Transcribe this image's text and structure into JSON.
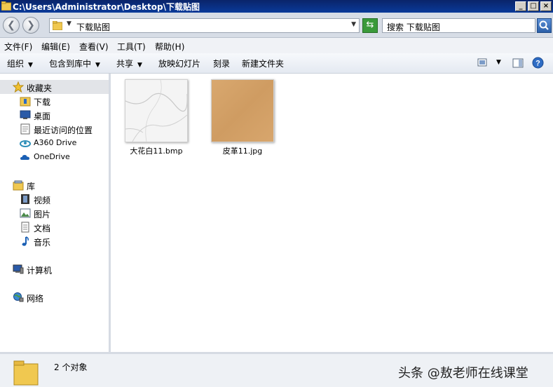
{
  "window": {
    "title": "C:\\Users\\Administrator\\Desktop\\下载贴图"
  },
  "address": {
    "path": "下载贴图",
    "search_placeholder": "搜索 下载贴图"
  },
  "menu": [
    "文件(F)",
    "编辑(E)",
    "查看(V)",
    "工具(T)",
    "帮助(H)"
  ],
  "toolbar": {
    "organize": "组织",
    "include": "包含到库中",
    "share": "共享",
    "slideshow": "放映幻灯片",
    "burn": "刻录",
    "new_folder": "新建文件夹"
  },
  "sidebar": {
    "favorites": "收藏夹",
    "fav_items": [
      "下载",
      "桌面",
      "最近访问的位置",
      "A360 Drive",
      "OneDrive"
    ],
    "library": "库",
    "lib_items": [
      "视频",
      "图片",
      "文档",
      "音乐"
    ],
    "computer": "计算机",
    "network": "网络"
  },
  "files": [
    {
      "name": "大花白11.bmp",
      "thumb": "marble"
    },
    {
      "name": "皮革11.jpg",
      "thumb": "leather"
    }
  ],
  "status": {
    "count": "2 个对象"
  },
  "watermark": "头条 @敖老师在线课堂",
  "colors": {
    "accent": "#0a246a",
    "leather": "#d7a46c",
    "marble": "#f3f3f3"
  }
}
